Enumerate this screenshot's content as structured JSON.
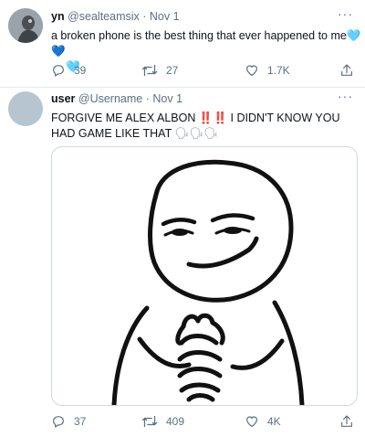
{
  "tweets": [
    {
      "display_name": "yn",
      "handle": "@sealteamsix",
      "separator": "·",
      "date": "Nov 1",
      "text_before": "a broken phone is the best thing that ever happened to me",
      "emoji_1": "🩵",
      "emoji_2": "💙",
      "emoji_3": "🩵",
      "counts": {
        "replies": "39",
        "retweets": "27",
        "likes": "1.7K"
      }
    },
    {
      "display_name": "user",
      "handle": "@Username",
      "separator": "·",
      "date": "Nov 1",
      "text_part1": "FORGIVE ME ALEX ALBON",
      "bangs": "‼️‼️",
      "text_part2": "I DIDN'T KNOW YOU HAD GAME LIKE THAT",
      "emojis": "🗣🗣🗣",
      "counts": {
        "replies": "37",
        "retweets": "409",
        "likes": "4K"
      }
    }
  ],
  "more_label": "···",
  "icons": [
    "more-icon",
    "reply-icon",
    "retweet-icon",
    "like-icon",
    "share-icon"
  ],
  "colors": {
    "meta": "#5b7083",
    "divider": "#e6ecf0",
    "red": "#e0245e"
  }
}
